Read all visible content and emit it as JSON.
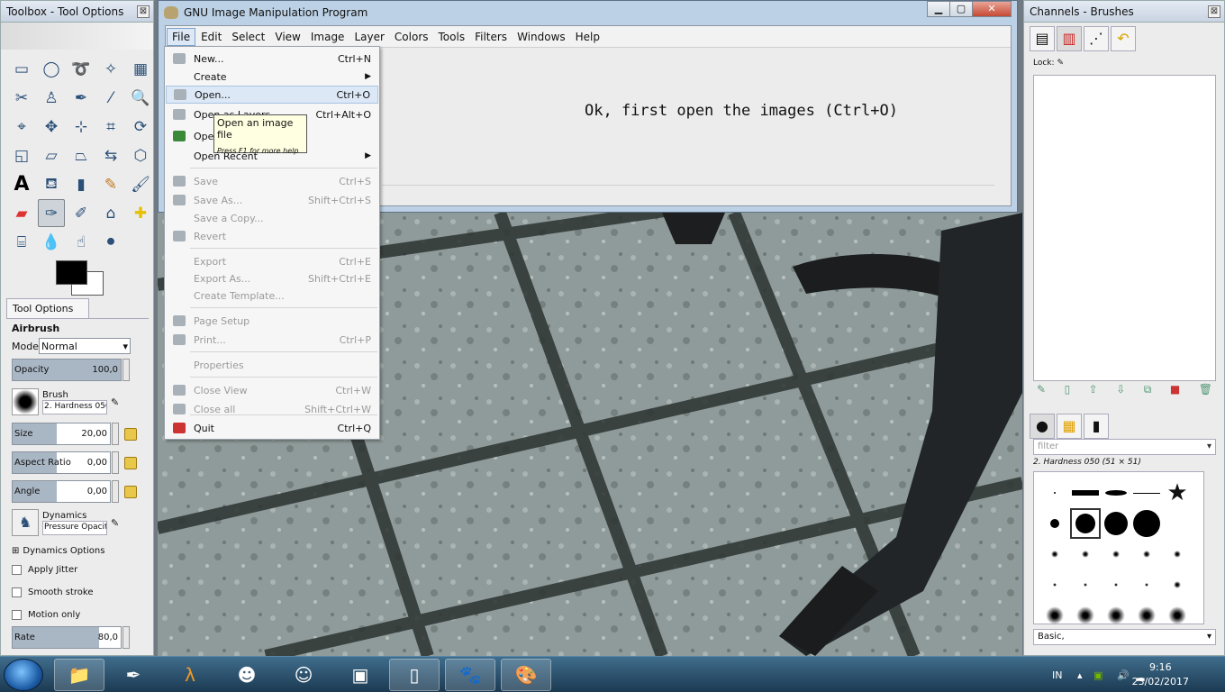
{
  "toolbox": {
    "title": "Toolbox - Tool Options",
    "close": "⊠"
  },
  "tool_options": {
    "tab_label": "Tool Options",
    "tool_name": "Airbrush",
    "mode_label": "Mode:",
    "mode_value": "Normal",
    "opacity_label": "Opacity",
    "opacity_value": "100,0",
    "opacity_fraction": 1.0,
    "brush_label": "Brush",
    "brush_value": "2. Hardness 050",
    "size_label": "Size",
    "size_value": "20,00",
    "aspect_label": "Aspect Ratio",
    "aspect_value": "0,00",
    "angle_label": "Angle",
    "angle_value": "0,00",
    "dynamics_label": "Dynamics",
    "dynamics_value": "Pressure Opacit",
    "dynamics_options": "Dynamics Options",
    "apply_jitter": "Apply Jitter",
    "smooth_stroke": "Smooth stroke",
    "motion_only": "Motion only",
    "rate_label": "Rate",
    "rate_value": "80,0"
  },
  "main_window": {
    "title": "GNU Image Manipulation Program",
    "menus": [
      "File",
      "Edit",
      "Select",
      "View",
      "Image",
      "Layer",
      "Colors",
      "Tools",
      "Filters",
      "Windows",
      "Help"
    ],
    "message": "Ok, first open the images (Ctrl+O)"
  },
  "file_menu": {
    "items": [
      {
        "label": "New...",
        "shortcut": "Ctrl+N"
      },
      {
        "label": "Create",
        "shortcut": ""
      },
      {
        "label": "Open...",
        "shortcut": "Ctrl+O"
      },
      {
        "label": "Open as Layers",
        "shortcut": "Ctrl+Alt+O"
      },
      {
        "label": "Open Location...",
        "shortcut": ""
      },
      {
        "label": "Open Recent",
        "shortcut": ""
      },
      {
        "label": "Save",
        "shortcut": "Ctrl+S"
      },
      {
        "label": "Save As...",
        "shortcut": "Shift+Ctrl+S"
      },
      {
        "label": "Save a Copy...",
        "shortcut": ""
      },
      {
        "label": "Revert",
        "shortcut": ""
      },
      {
        "label": "Export",
        "shortcut": "Ctrl+E"
      },
      {
        "label": "Export As...",
        "shortcut": "Shift+Ctrl+E"
      },
      {
        "label": "Create Template...",
        "shortcut": ""
      },
      {
        "label": "Page Setup",
        "shortcut": ""
      },
      {
        "label": "Print...",
        "shortcut": "Ctrl+P"
      },
      {
        "label": "Properties",
        "shortcut": ""
      },
      {
        "label": "Close View",
        "shortcut": "Ctrl+W"
      },
      {
        "label": "Close all",
        "shortcut": "Shift+Ctrl+W"
      },
      {
        "label": "Quit",
        "shortcut": "Ctrl+Q"
      }
    ]
  },
  "tooltip": {
    "title": "Open an image file",
    "help": "Press F1 for more help"
  },
  "dock": {
    "title": "Channels - Brushes",
    "lock_label": "Lock:",
    "filter_placeholder": "filter",
    "brush_name": "2. Hardness 050 (51 × 51)",
    "preset": "Basic,"
  },
  "taskbar": {
    "lang": "IN",
    "time": "9:16",
    "date": "23/02/2017"
  }
}
